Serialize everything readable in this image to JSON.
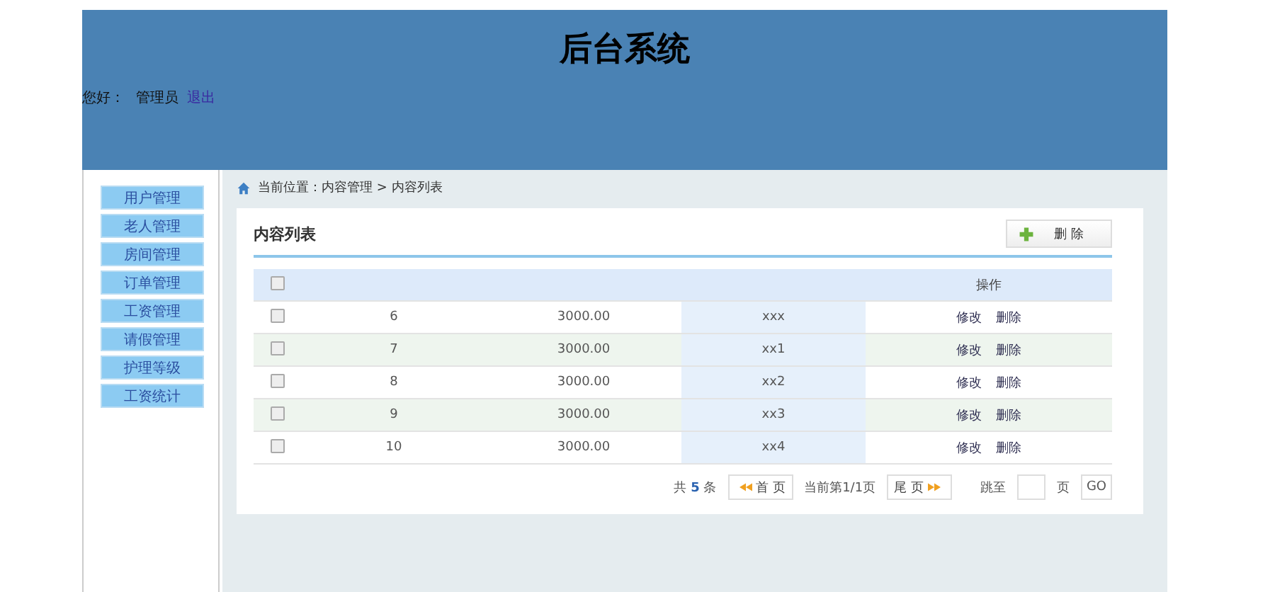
{
  "header": {
    "title": "后台系统",
    "greeting": "您好：",
    "user": "管理员",
    "logout": "退出"
  },
  "sidebar": {
    "items": [
      {
        "label": "用户管理"
      },
      {
        "label": "老人管理"
      },
      {
        "label": "房间管理"
      },
      {
        "label": "订单管理"
      },
      {
        "label": "工资管理"
      },
      {
        "label": "请假管理"
      },
      {
        "label": "护理等级"
      },
      {
        "label": "工资统计"
      }
    ]
  },
  "breadcrumb": "当前位置：内容管理 > 内容列表",
  "panel": {
    "title": "内容列表",
    "delete_button": "删 除"
  },
  "table": {
    "select_all_checked": false,
    "action_column": "操作",
    "rows": [
      {
        "checked": false,
        "cells": [
          "6",
          "3000.00",
          "xxx"
        ],
        "actions": [
          "修改",
          "删除"
        ]
      },
      {
        "checked": false,
        "cells": [
          "7",
          "3000.00",
          "xx1"
        ],
        "actions": [
          "修改",
          "删除"
        ]
      },
      {
        "checked": false,
        "cells": [
          "8",
          "3000.00",
          "xx2"
        ],
        "actions": [
          "修改",
          "删除"
        ]
      },
      {
        "checked": false,
        "cells": [
          "9",
          "3000.00",
          "xx3"
        ],
        "actions": [
          "修改",
          "删除"
        ]
      },
      {
        "checked": false,
        "cells": [
          "10",
          "3000.00",
          "xx4"
        ],
        "actions": [
          "修改",
          "删除"
        ]
      }
    ]
  },
  "pager": {
    "total_prefix": "共",
    "total": "5",
    "total_suffix": "条",
    "first": "首 页",
    "page_info": "当前第1/1页",
    "last": "尾 页",
    "jump_label": "跳至",
    "page_unit": "页",
    "go": "GO"
  }
}
